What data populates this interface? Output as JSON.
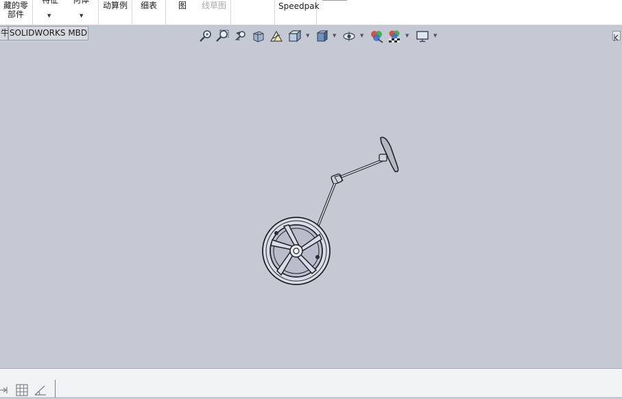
{
  "ribbon": {
    "groups": [
      {
        "line1": "藏的零",
        "line2": "部件"
      },
      {
        "line1": "特征",
        "line2": ""
      },
      {
        "line1": "何体",
        "line2": ""
      },
      {
        "line1": "动算例",
        "line2": ""
      },
      {
        "line1": "细表",
        "line2": ""
      },
      {
        "line1": "图",
        "line2": "线草图"
      },
      {
        "line1": "Speedpak",
        "line2": ""
      }
    ]
  },
  "tabs": {
    "stub_label": "牛",
    "mbd_label": "SOLIDWORKS MBD"
  },
  "view_toolbar": {
    "icons": [
      "zoom-to-fit-icon",
      "zoom-to-area-icon",
      "previous-view-icon",
      "section-view-icon",
      "dynamic-annotation-icon",
      "view-orientation-icon",
      "display-style-icon",
      "hide-show-items-icon",
      "edit-appearance-icon",
      "apply-scene-icon",
      "view-settings-icon"
    ]
  },
  "model": {
    "description_icon": "steering-wheel-linkage-model"
  },
  "colors": {
    "viewport_bg": "#c5c9d3",
    "ribbon_bg": "#ffffff",
    "status_bg": "#f2f3f5"
  }
}
